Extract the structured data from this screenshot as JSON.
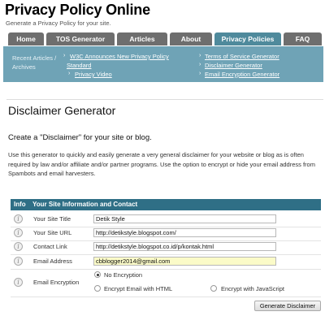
{
  "header": {
    "site_title": "Privacy Policy Online",
    "tagline": "Generate a Privacy Policy for your site."
  },
  "nav": {
    "tabs": [
      {
        "label": "Home"
      },
      {
        "label": "TOS Generator"
      },
      {
        "label": "Articles"
      },
      {
        "label": "About"
      },
      {
        "label": "Privacy Policies"
      },
      {
        "label": "FAQ"
      }
    ]
  },
  "subnav": {
    "recent_label": "Recent Articles / Archives",
    "links": [
      "W3C Announces New Privacy Policy Standard",
      "Privacy Video",
      "Terms of Service Generator",
      "Disclaimer Generator",
      "Email Encryption Generator"
    ]
  },
  "main": {
    "page_title": "Disclaimer Generator",
    "subtitle": "Create a \"Disclaimer\" for your site or blog.",
    "intro": "Use this generator to quickly and easily generate a very general disclaimer for your website or blog as is often required by law and/or affiliate and/or partner programs. Use the option to encrypt or hide your email address from Spambots and email harvesters."
  },
  "form": {
    "header_info": "Info",
    "header_title": "Your Site Information and Contact",
    "info_glyph": "i",
    "fields": [
      {
        "label": "Your Site Title",
        "value": "Detik Style"
      },
      {
        "label": "Your Site URL",
        "value": "http://detikstyle.blogspot.com/"
      },
      {
        "label": "Contact Link",
        "value": "http://detikstyle.blogspot.co.id/p/kontak.html"
      },
      {
        "label": "Email Address",
        "value": "cbblogger2014@gmail.com"
      }
    ],
    "encryption": {
      "label": "Email Encryption",
      "options": [
        "No Encryption",
        "Encrypt Email with HTML",
        "Encrypt with JavaScript"
      ],
      "selected": "No Encryption"
    },
    "submit_label": "Generate Disclaimer"
  },
  "colors": {
    "nav_tab": "#6e6e6e",
    "nav_tab_active": "#4f8a9c",
    "subnav_bg": "#6fa3b6",
    "table_header": "#2f6f86",
    "email_highlight": "#fbfbc8"
  }
}
